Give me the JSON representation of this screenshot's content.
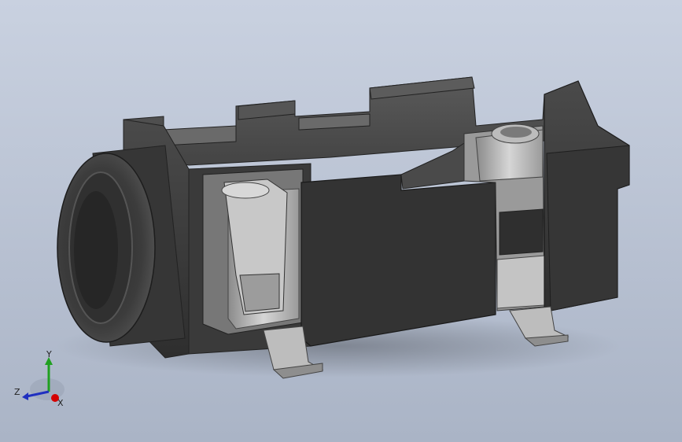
{
  "viewport": {
    "background_top": "#c9d1e0",
    "background_bottom": "#aab4c6"
  },
  "model": {
    "body_color": "#3b3b3b",
    "metal_color": "#b8b8b8"
  },
  "triad": {
    "x_label": "X",
    "y_label": "Y",
    "z_label": "Z",
    "x_color": "#d40000",
    "y_color": "#20a020",
    "z_color": "#2030c0"
  }
}
